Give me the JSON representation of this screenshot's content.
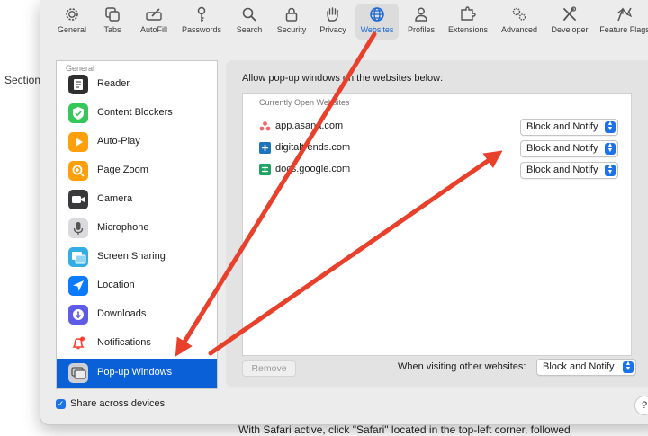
{
  "page": {
    "left_text": "Section",
    "bottom_text": "With Safari active, click \"Safari\" located in the top-left corner, followed"
  },
  "toolbar": {
    "items": [
      {
        "label": "General",
        "icon": "gear-icon"
      },
      {
        "label": "Tabs",
        "icon": "tabs-icon"
      },
      {
        "label": "AutoFill",
        "icon": "autofill-icon"
      },
      {
        "label": "Passwords",
        "icon": "key-icon"
      },
      {
        "label": "Search",
        "icon": "search-icon"
      },
      {
        "label": "Security",
        "icon": "lock-icon"
      },
      {
        "label": "Privacy",
        "icon": "hand-icon"
      },
      {
        "label": "Websites",
        "icon": "globe-icon",
        "active": true
      },
      {
        "label": "Profiles",
        "icon": "person-icon"
      },
      {
        "label": "Extensions",
        "icon": "puzzle-icon"
      },
      {
        "label": "Advanced",
        "icon": "gears-icon"
      },
      {
        "label": "Developer",
        "icon": "tools-icon"
      },
      {
        "label": "Feature Flags",
        "icon": "flags-icon"
      }
    ]
  },
  "sidebar": {
    "header": "General",
    "items": [
      {
        "label": "Reader",
        "icon": "reader-icon"
      },
      {
        "label": "Content Blockers",
        "icon": "content-blockers-icon"
      },
      {
        "label": "Auto-Play",
        "icon": "play-icon"
      },
      {
        "label": "Page Zoom",
        "icon": "zoom-icon"
      },
      {
        "label": "Camera",
        "icon": "camera-icon"
      },
      {
        "label": "Microphone",
        "icon": "microphone-icon"
      },
      {
        "label": "Screen Sharing",
        "icon": "screen-sharing-icon"
      },
      {
        "label": "Location",
        "icon": "location-icon"
      },
      {
        "label": "Downloads",
        "icon": "downloads-icon"
      },
      {
        "label": "Notifications",
        "icon": "bell-icon"
      },
      {
        "label": "Pop-up Windows",
        "icon": "popup-windows-icon",
        "selected": true
      }
    ]
  },
  "main": {
    "title": "Allow pop-up windows on the websites below:",
    "list_header": "Currently Open Websites",
    "websites": [
      {
        "site": "app.asana.com",
        "setting": "Block and Notify",
        "icon": "asana-icon"
      },
      {
        "site": "digitaltrends.com",
        "setting": "Block and Notify",
        "icon": "digitaltrends-icon"
      },
      {
        "site": "docs.google.com",
        "setting": "Block and Notify",
        "icon": "google-docs-icon"
      }
    ],
    "remove_label": "Remove",
    "other_label": "When visiting other websites:",
    "other_setting": "Block and Notify"
  },
  "footer": {
    "share_label": "Share across devices",
    "share_checked": true,
    "help_label": "?"
  },
  "colors": {
    "accent": "#0a60d6",
    "annotation_arrow": "#e8402a"
  }
}
